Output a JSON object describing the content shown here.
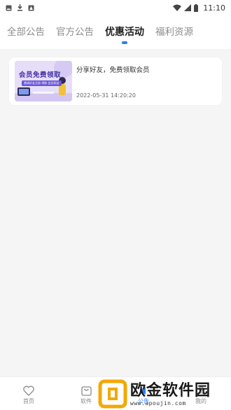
{
  "status_bar": {
    "time": "11:10"
  },
  "tabs": [
    {
      "label": "全部公告",
      "active": false
    },
    {
      "label": "官方公告",
      "active": false
    },
    {
      "label": "优惠活动",
      "active": true
    },
    {
      "label": "福利资源",
      "active": false
    }
  ],
  "announcements": [
    {
      "thumbnail_title": "会员免费领取",
      "thumbnail_subtitle": "邀请好友注册 领取 会员权益",
      "title": "分享好友，免费领取会员",
      "date": "2022-05-31 14:20:20"
    }
  ],
  "bottom_nav": [
    {
      "label": "首页",
      "icon": "heart-icon",
      "active": false
    },
    {
      "label": "软件",
      "icon": "bag-icon",
      "active": false
    },
    {
      "label": "公告",
      "icon": "notice-icon",
      "active": true
    },
    {
      "label": "我的",
      "icon": "user-icon",
      "active": false
    }
  ],
  "watermark": {
    "text": "欧金软件园",
    "url": "www.apoujin.com"
  },
  "colors": {
    "accent": "#2d7cf6",
    "page_background": "#f5f5f6",
    "watermark_logo": "#f2a900"
  }
}
